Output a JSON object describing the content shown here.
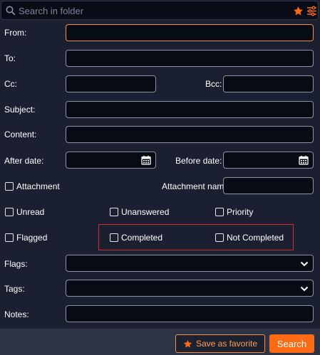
{
  "search": {
    "placeholder": "Search in folder"
  },
  "labels": {
    "from": "From:",
    "to": "To:",
    "cc": "Cc:",
    "bcc": "Bcc:",
    "subject": "Subject:",
    "content": "Content:",
    "after_date": "After date:",
    "before_date": "Before date:",
    "attachment_name": "Attachment name:",
    "flags": "Flags:",
    "tags": "Tags:",
    "notes": "Notes:"
  },
  "checkboxes": {
    "attachment": "Attachment",
    "unread": "Unread",
    "unanswered": "Unanswered",
    "priority": "Priority",
    "flagged": "Flagged",
    "completed": "Completed",
    "not_completed": "Not Completed"
  },
  "buttons": {
    "save_favorite": "Save as favorite",
    "search": "Search"
  },
  "colors": {
    "accent": "#ff6b14",
    "background": "#1a2030",
    "field_bg": "#070b14",
    "highlight": "#d42a2a"
  },
  "icons": [
    "search-icon",
    "star-icon",
    "filter-settings-icon",
    "calendar-icon",
    "chevron-down-icon"
  ]
}
